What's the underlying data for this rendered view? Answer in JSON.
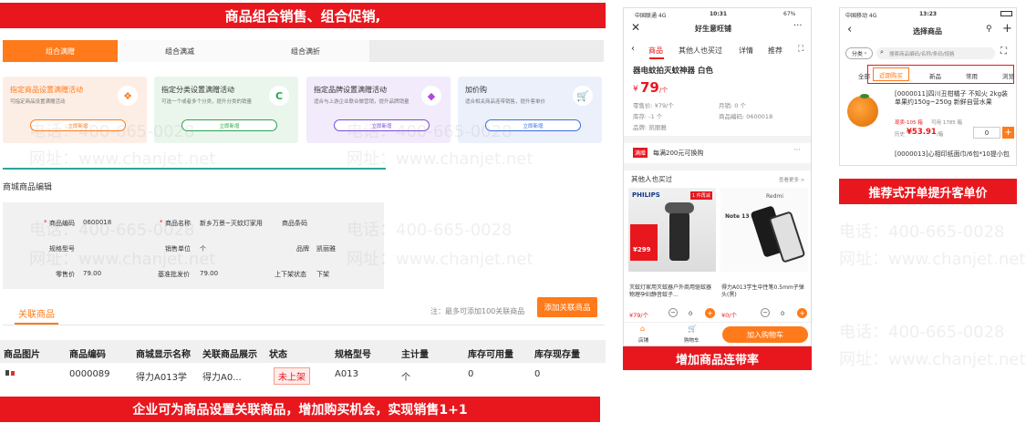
{
  "top_banner": "商品组合销售、组合促销,",
  "bottom_banner": "企业可为商品设置关联商品，增加购买机会，实现销售1+1",
  "tabs": [
    "组合满赠",
    "组合满减",
    "组合满折"
  ],
  "cards": [
    {
      "title": "指定商品设置满赠活动",
      "desc": "可指定商品设置满赠活动",
      "btn": "立即新增",
      "bg": "#fdeee5",
      "color": "#ff7a1a",
      "icon": "🎁"
    },
    {
      "title": "指定分类设置满赠活动",
      "desc": "可选一个或者多个分类，提升分类的销量",
      "btn": "立即新增",
      "bg": "#eaf6ec",
      "color": "#333",
      "icon": "✓"
    },
    {
      "title": "指定品牌设置满赠活动",
      "desc": "适合与上游企业联合做营销，提升品牌销量",
      "btn": "立即新增",
      "bg": "#f2ebfb",
      "color": "#333",
      "icon": "◆"
    },
    {
      "title": "加价购",
      "desc": "适合相关商品连带销售，提升客单价",
      "btn": "立即新增",
      "bg": "#ebf0fb",
      "color": "#333",
      "icon": "🛒"
    }
  ],
  "edit": {
    "section_title": "商城商品编辑",
    "code_label": "商品编码",
    "code_value": "0600018",
    "name_label": "商品名称",
    "name_value": "新乡万景~灭蚊灯家用",
    "barcode_label": "商品条码",
    "model_label": "规格型号",
    "unit_label": "销售单位",
    "unit_value": "个",
    "brand_label": "品牌",
    "brand_value": "凯丽雅",
    "retail_label": "零售价",
    "retail_value": "79.00",
    "wholesale_label": "基准批发价",
    "wholesale_value": "79.00",
    "status_label": "上下架状态",
    "status_value": "下架"
  },
  "related": {
    "tab": "关联商品",
    "note": "注：最多可添加100关联商品",
    "add_btn": "添加关联商品",
    "headers": [
      "商品图片",
      "商品编码",
      "商城显示名称",
      "关联商品展示",
      "状态",
      "规格型号",
      "主计量",
      "库存可用量",
      "库存现存量"
    ],
    "row": {
      "code": "0000089",
      "name": "得力A013学",
      "display": "得力A0...",
      "status": "未上架",
      "model": "A013",
      "unit": "个",
      "avail": "0",
      "stock": "0"
    }
  },
  "phone1": {
    "carrier": "中国联通 4G",
    "time": "10:31",
    "battery": "67%",
    "title": "好生意旺铺",
    "tabs": [
      "商品",
      "其他人也买过",
      "详情",
      "推荐"
    ],
    "product_name": "器电蚊拍灭蚊神器 白色",
    "price_symbol": "¥",
    "price": "79",
    "price_unit": "/个",
    "ref_price": "零售价: ¥79/个",
    "monthly": "月销: 0 个",
    "stock": "库存: -1 个",
    "code": "商品编码: 0600018",
    "brand": "品牌: 凯丽雅",
    "promo_tag": "满赠",
    "promo_text": "每满200元可换购",
    "others_title": "其他人也买过",
    "see_more": "查看更多 >",
    "item1_brand": "PHILIPS",
    "item1_tag": "1 件再减",
    "item1_badge": "¥299",
    "item1_name": "灭蚊灯家用灭蚊器户外商用驱蚊器物理孕妇静音蚊子...",
    "item1_price": "¥79/个",
    "item1_qty": "0",
    "item2_brand": "Redmi",
    "item2_model": "Note 13 5G",
    "item2_name": "得力A013学生中性笔0.5mm子弹头(黑)",
    "item2_price": "¥0/个",
    "item2_qty": "0",
    "nav_store": "店铺",
    "nav_cart": "购物车",
    "add_cart": "加入购物车"
  },
  "phone1_caption": "增加商品连带率",
  "phone2": {
    "carrier": "中国移动 4G",
    "time": "13:23",
    "title": "选择商品",
    "category": "分类",
    "search_placeholder": "搜索商品编码/名称/条码/规格",
    "filters": [
      "全部",
      "近期购买",
      "新品",
      "常用",
      "浏览"
    ],
    "item1_name": "[0000011]四川丑柑橘子 不知火 2kg装 单果约150g~250g 新鲜自营水果",
    "item1_price": "现卖-105 箱",
    "item1_stock": "可用 1785 箱",
    "item1_hist": "历史",
    "item1_hist_price": "¥53.91",
    "item1_hist_unit": "/箱",
    "item1_qty": "0",
    "item2_name": "[0000013]心相印纸面巾/6包*10提小包"
  },
  "phone2_caption": "推荐式开单提升客单价",
  "watermark": [
    "电话：400-665-0028",
    "网址：www.chanjet.net"
  ],
  "colors": {
    "accent": "#e8171e",
    "orange": "#ff7a1a",
    "teal": "#2aa59c"
  }
}
